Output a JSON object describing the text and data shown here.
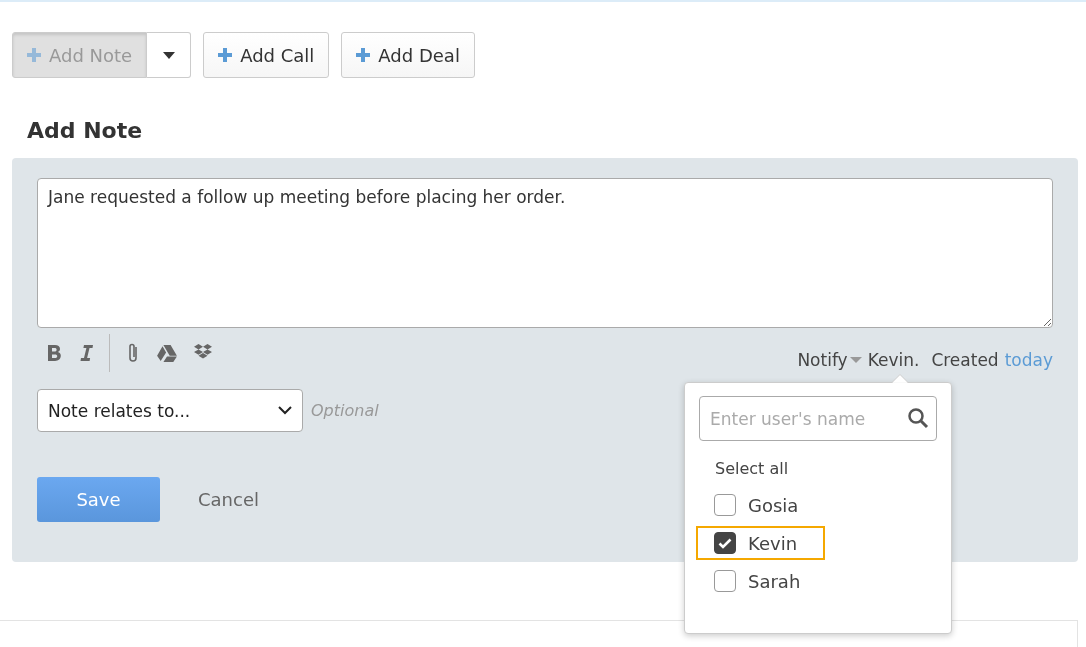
{
  "action_buttons": [
    {
      "label": "Add Note",
      "selected": true,
      "has_menu": true
    },
    {
      "label": "Add Call",
      "selected": false,
      "has_menu": false
    },
    {
      "label": "Add Deal",
      "selected": false,
      "has_menu": false
    }
  ],
  "heading": "Add Note",
  "note": {
    "value": "Jane requested a follow up meeting before placing her order."
  },
  "notify": {
    "label": "Notify",
    "recipients": "Kevin.",
    "created_label": "Created",
    "created_link": "today"
  },
  "relates_select": {
    "value": "Note relates to...",
    "hint": "Optional"
  },
  "buttons": {
    "save": "Save",
    "cancel": "Cancel"
  },
  "notify_popup": {
    "search_placeholder": "Enter user's name",
    "select_all": "Select all",
    "users": [
      {
        "name": "Gosia",
        "checked": false,
        "highlighted": false
      },
      {
        "name": "Kevin",
        "checked": true,
        "highlighted": true
      },
      {
        "name": "Sarah",
        "checked": false,
        "highlighted": false
      }
    ]
  }
}
